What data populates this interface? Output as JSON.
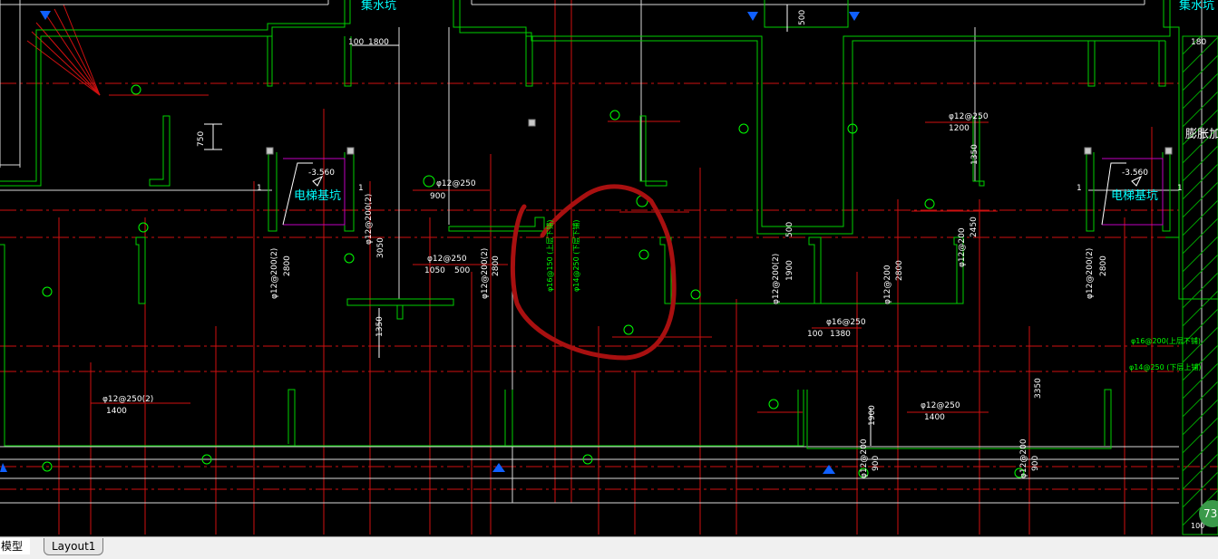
{
  "tabs": {
    "model": "模型",
    "layout1": "Layout1"
  },
  "badge": "73",
  "pits": {
    "left_label": "电梯基坑",
    "right_label": "电梯基坑",
    "left_level": "-3.560",
    "right_level": "-3.560"
  },
  "top_labels": {
    "sump_left": "集水坑",
    "sump_right": "集水坑",
    "dim_100": "100",
    "dim_1800": "1800",
    "dim_180": "180",
    "dim_500": "500",
    "side_text": "膨胀加强"
  },
  "rebar": {
    "r1": "φ12@250",
    "r1_len": "900",
    "r2": "φ12@250",
    "r2_len": "1050",
    "r2_len2": "500",
    "r3": "φ12@250",
    "r3_len": "1200",
    "r4": "φ12@250(2)",
    "r4_len": "1400",
    "r5": "φ16@250",
    "r5_len": "1380",
    "r5_pre": "100",
    "r6": "φ12@250",
    "r6_len": "1400",
    "r7": "φ16@200(上层下铺)",
    "r8": "φ14@250 (下层上铺)",
    "v1": "φ12@200(2)",
    "v1_len": "2800",
    "v2": "φ12@200(2)",
    "v2_len": "3050",
    "v3": "φ12@200(2)",
    "v3_len": "2800",
    "v4": "φ16@150 (上层下铺)",
    "v5": "φ14@250 (下层下铺)",
    "v6": "φ12@200(2)",
    "v6_len": "1900",
    "v7": "φ12@200",
    "v7_len": "2800",
    "v8": "φ12@200",
    "v8_len": "2450",
    "v9": "φ12@200(2)",
    "v9_len": "2800",
    "v10": "φ12@200",
    "v10_len": "900",
    "v11": "φ12@200",
    "v11_len": "900",
    "d750": "750",
    "d1350": "1350",
    "d1350b": "1350",
    "d1900": "1900",
    "d3350": "3350",
    "d500": "500",
    "d100": "100",
    "d1": "1"
  }
}
